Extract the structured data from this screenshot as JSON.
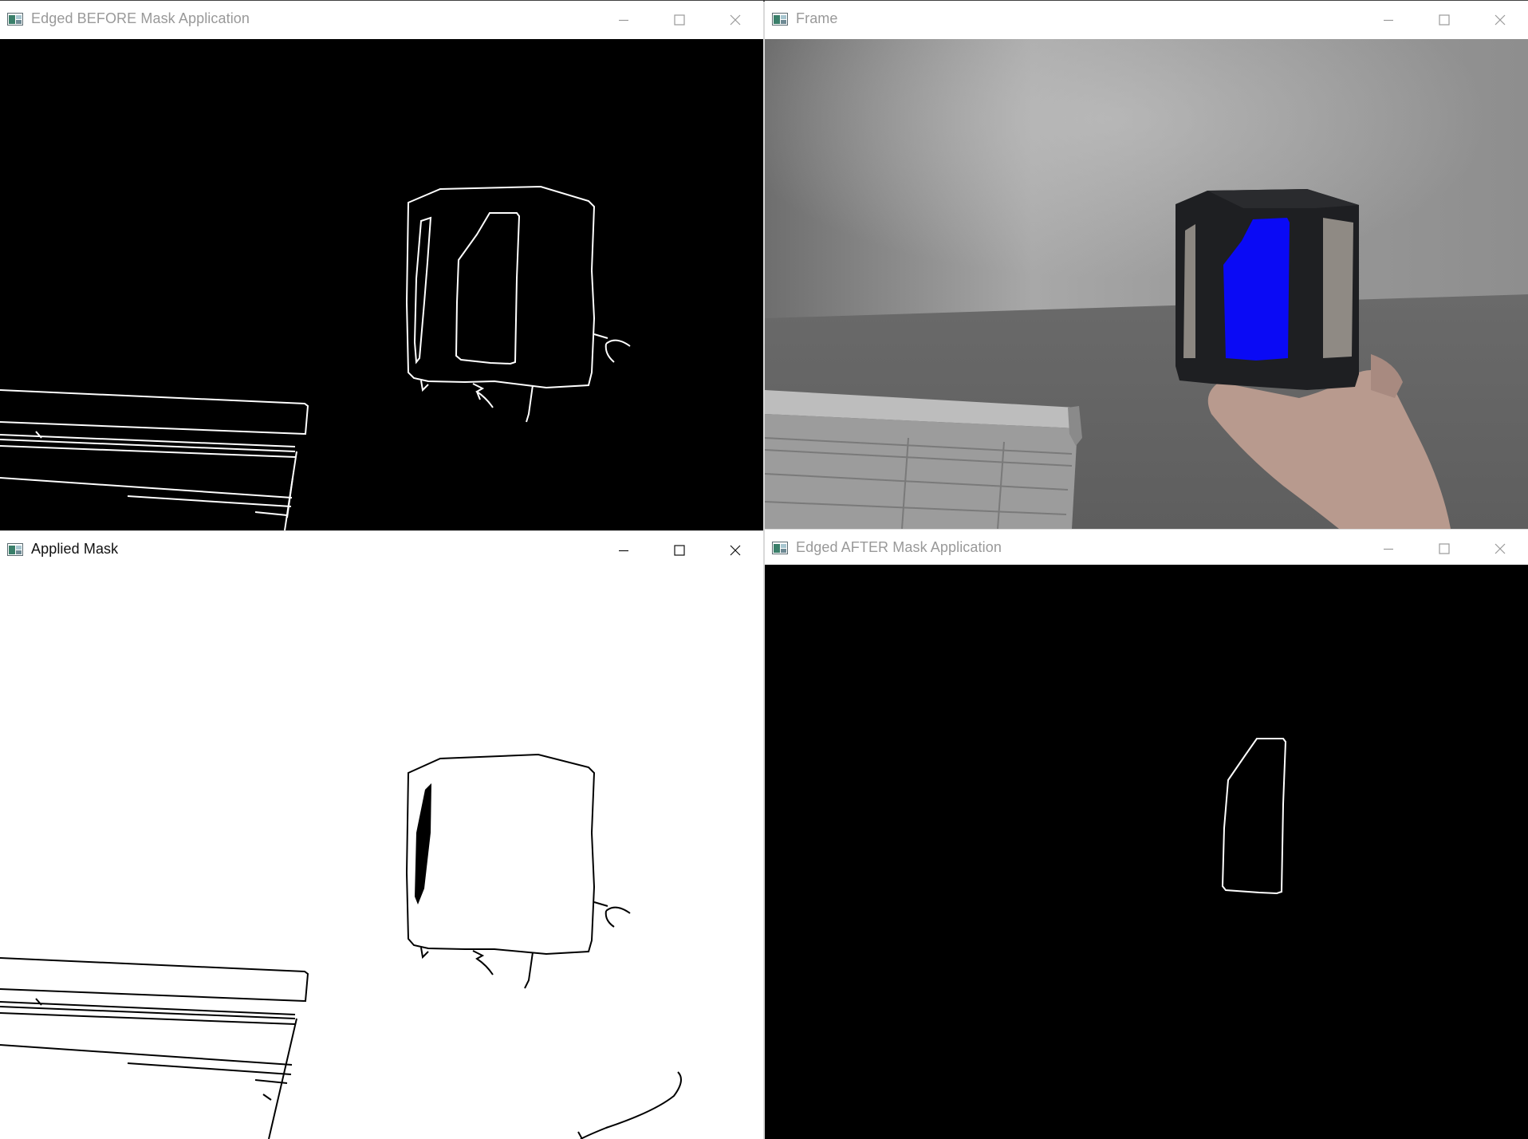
{
  "windows": {
    "edged_before": {
      "title": "Edged BEFORE Mask Application"
    },
    "frame": {
      "title": "Frame"
    },
    "applied_mask": {
      "title": "Applied Mask"
    },
    "edged_after": {
      "title": "Edged AFTER Mask Application"
    }
  },
  "icons": {
    "app": "opencv-window-icon",
    "minimize": "minimize-icon",
    "maximize": "maximize-icon",
    "close": "close-icon"
  },
  "colors": {
    "mask_highlight": "#0a0af5",
    "edge_line": "#ffffff",
    "mask_edge_line": "#000000",
    "inactive_title": "#999999",
    "active_title": "#111111"
  }
}
